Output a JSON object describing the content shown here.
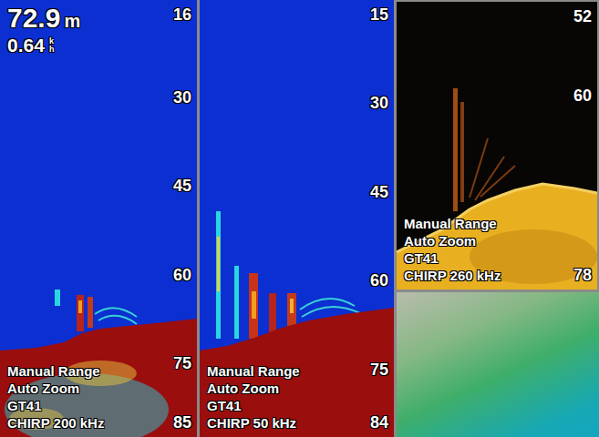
{
  "readout": {
    "depth": "72.9",
    "depth_unit": "m",
    "speed": "0.64",
    "speed_unit": [
      "k",
      "h"
    ]
  },
  "panels": [
    {
      "kind": "color-sonar",
      "scale": [
        "16",
        "30",
        "45",
        "60",
        "75",
        "85"
      ],
      "labels": [
        "Manual Range",
        "Auto Zoom",
        "GT41",
        "CHIRP 200 kHz"
      ]
    },
    {
      "kind": "color-sonar-low",
      "scale": [
        "15",
        "30",
        "45",
        "60",
        "75",
        "84"
      ],
      "labels": [
        "Manual Range",
        "Auto Zoom",
        "GT41",
        "CHIRP 50 kHz"
      ]
    },
    {
      "kind": "downvu",
      "scale": [
        "52",
        "60",
        "78"
      ],
      "labels": [
        "Manual Range",
        "Auto Zoom",
        "GT41",
        "CHIRP 260 kHz"
      ]
    }
  ]
}
